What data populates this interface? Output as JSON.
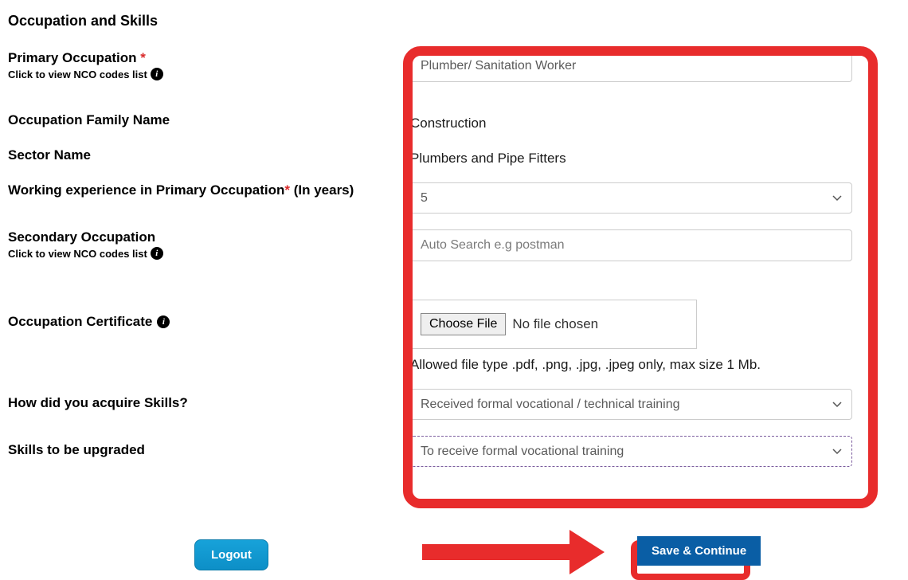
{
  "section_title": "Occupation and Skills",
  "primary_occupation": {
    "label": "Primary Occupation",
    "sublabel": "Click to view NCO codes list",
    "value": "Plumber/ Sanitation Worker"
  },
  "occupation_family": {
    "label": "Occupation Family Name",
    "value": "Construction"
  },
  "sector_name": {
    "label": "Sector Name",
    "value": "Plumbers and Pipe Fitters"
  },
  "experience": {
    "label_pre": "Working experience in Primary Occupation",
    "label_post": " (In years)",
    "value": "5"
  },
  "secondary_occupation": {
    "label": "Secondary Occupation",
    "sublabel": "Click to view NCO codes list",
    "placeholder": "Auto Search e.g postman"
  },
  "certificate": {
    "label": "Occupation Certificate",
    "choose_label": "Choose File",
    "nofile": "No file chosen",
    "hint": "Allowed file type .pdf, .png, .jpg, .jpeg only, max size 1 Mb."
  },
  "acquire_skills": {
    "label": "How did you acquire Skills?",
    "value": "Received formal vocational / technical training"
  },
  "upgrade_skills": {
    "label": "Skills to be upgraded",
    "value": "To receive formal vocational training"
  },
  "buttons": {
    "logout": "Logout",
    "save": "Save & Continue"
  },
  "symbols": {
    "asterisk": "*",
    "info": "i"
  }
}
